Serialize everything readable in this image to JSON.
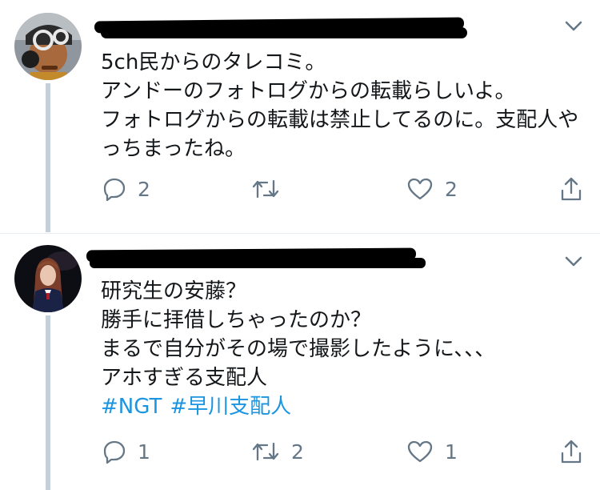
{
  "tweets": [
    {
      "avatar": "avatar-robot-illustration",
      "text": "5ch民からのタレコミ。\nアンドーのフォトログからの転載らしいよ。\nフォトログからの転載は禁止してるのに。支配人やっちまったね。",
      "hashtags": [],
      "replies": "2",
      "retweets": "",
      "likes": "2"
    },
    {
      "avatar": "avatar-photo-stage",
      "text": "研究生の安藤？\n勝手に拝借しちゃったのか？\nまるで自分がその場で撮影したように、、、\nアホすぎる支配人",
      "hashtags": [
        "#NGT",
        "#早川支配人"
      ],
      "replies": "1",
      "retweets": "2",
      "likes": "1"
    }
  ],
  "icons": [
    "reply-icon",
    "retweet-icon",
    "like-icon",
    "share-icon",
    "chevron-down-icon"
  ],
  "colors": {
    "text": "#14171a",
    "muted": "#657786",
    "link": "#1b95e0",
    "thread": "#c4d0db"
  }
}
